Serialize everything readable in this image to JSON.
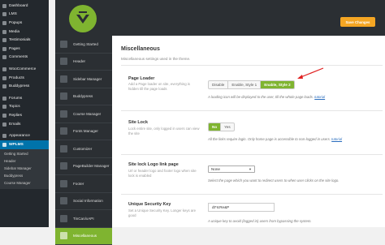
{
  "wp_menu": [
    {
      "label": "Dashboard"
    },
    {
      "label": "LMS"
    },
    {
      "label": "Popups"
    },
    {
      "label": "Media"
    },
    {
      "label": "Testimonials"
    },
    {
      "label": "Pages"
    },
    {
      "label": "Comments"
    },
    {
      "label": "WooCommerce"
    },
    {
      "label": "Products"
    },
    {
      "label": "Buddypress"
    },
    {
      "label": "Forums"
    },
    {
      "label": "Topics"
    },
    {
      "label": "Replies"
    },
    {
      "label": "Emails"
    },
    {
      "label": "Appearance"
    },
    {
      "label": "WPLMS"
    }
  ],
  "wp_submenu": [
    "Getting Started",
    "Header",
    "Sidebar Manager",
    "Buddypress",
    "Course Manager"
  ],
  "save_label": "Save Changes",
  "options_nav": [
    "Getting Started",
    "Header",
    "Sidebar Manager",
    "Buddypress",
    "Course Manager",
    "Fonts Manager",
    "Customizer",
    "PageBuilder Manager",
    "Footer",
    "Social Information",
    "TinCan/xAPI",
    "Miscellaneous"
  ],
  "active_nav": "Miscellaneous",
  "section": {
    "title": "Miscellaneous",
    "desc": "Miscellaneous settings used in the theme."
  },
  "page_loader": {
    "title": "Page Loader",
    "desc": "Add a Page loader on site, everything is hidden till the page loads",
    "options": [
      "Disable",
      "Enable, Style 1",
      "Enable, Style 2"
    ],
    "selected": "Enable, Style 2",
    "hint": "A loading icon will be displayed to the user, till the whole page loads.",
    "link": "tutorial"
  },
  "site_lock": {
    "title": "Site Lock",
    "desc": "Lock entire site, only logged in users can view the site",
    "options": [
      "No",
      "Yes"
    ],
    "selected": "No",
    "hint": "All the links require login. Only home page is accessible to non-logged in users.",
    "link": "tutorial"
  },
  "logo_link": {
    "title": "Site lock Logo link page",
    "desc": "Url or header logo and footer logo when site lock is enabled",
    "value": "None",
    "hint": "Select the page which you want to redirect users to when user clicks on the site logo."
  },
  "security_key": {
    "title": "Unique Security Key",
    "desc": "Set a Unique Security Key. Longer keys are good",
    "value": "dt*IcRe&P",
    "hint": "A unique key to avoid (logged in) users from bypassing the system."
  },
  "colors": {
    "accent": "#7fb430",
    "wp_active": "#0073aa",
    "save": "#f5a623",
    "arrow": "#e02020"
  }
}
